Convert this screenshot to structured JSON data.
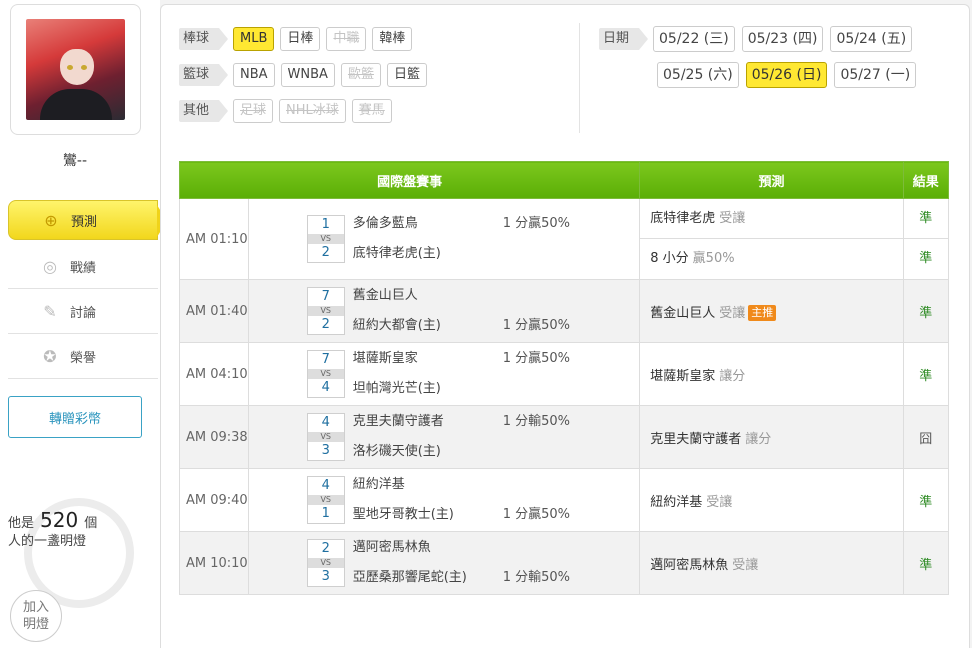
{
  "user": {
    "name": "鸞--"
  },
  "menu": [
    {
      "label": "預測",
      "icon": "crosshair-icon",
      "glyph": "⊕",
      "active": true
    },
    {
      "label": "戰績",
      "icon": "record-icon",
      "glyph": "◎",
      "active": false
    },
    {
      "label": "討論",
      "icon": "discussion-icon",
      "glyph": "✎",
      "active": false
    },
    {
      "label": "榮譽",
      "icon": "medal-icon",
      "glyph": "✪",
      "active": false
    }
  ],
  "gift_button": "轉贈彩幣",
  "light": {
    "text_prefix": "他是",
    "count": "520",
    "text_suffix": "個",
    "text_line2": "人的一盞明燈",
    "join": "加入明燈"
  },
  "filters": [
    {
      "category": "棒球",
      "chips": [
        {
          "label": "MLB",
          "state": "active"
        },
        {
          "label": "日棒",
          "state": "normal"
        },
        {
          "label": "中職",
          "state": "disabled"
        },
        {
          "label": "韓棒",
          "state": "normal"
        }
      ]
    },
    {
      "category": "籃球",
      "chips": [
        {
          "label": "NBA",
          "state": "normal"
        },
        {
          "label": "WNBA",
          "state": "normal"
        },
        {
          "label": "歐籃",
          "state": "disabled"
        },
        {
          "label": "日籃",
          "state": "normal"
        }
      ]
    },
    {
      "category": "其他",
      "chips": [
        {
          "label": "足球",
          "state": "disabled"
        },
        {
          "label": "NHL冰球",
          "state": "disabled"
        },
        {
          "label": "賽馬",
          "state": "disabled"
        }
      ]
    }
  ],
  "dates": {
    "label": "日期",
    "row1": [
      {
        "label": "05/22 (三)",
        "active": false
      },
      {
        "label": "05/23 (四)",
        "active": false
      },
      {
        "label": "05/24 (五)",
        "active": false
      }
    ],
    "row2": [
      {
        "label": "05/25 (六)",
        "active": false
      },
      {
        "label": "05/26 (日)",
        "active": true
      },
      {
        "label": "05/27 (一)",
        "active": false
      }
    ]
  },
  "table": {
    "headers": {
      "match": "國際盤賽事",
      "prediction": "預測",
      "result": "結果"
    },
    "vs_label": "VS",
    "games": [
      {
        "time": "AM 01:10",
        "away": {
          "score": "1",
          "name": "多倫多藍鳥",
          "odds": "1 分贏50%"
        },
        "home": {
          "score": "2",
          "name": "底特律老虎(主)",
          "odds": ""
        },
        "predictions": [
          {
            "main": "底特律老虎",
            "sub": "受讓",
            "badge": "",
            "result": "準",
            "result_type": "win"
          },
          {
            "main": "8 小分",
            "sub": "贏50%",
            "badge": "",
            "result": "準",
            "result_type": "win"
          }
        ]
      },
      {
        "time": "AM 01:40",
        "away": {
          "score": "7",
          "name": "舊金山巨人",
          "odds": ""
        },
        "home": {
          "score": "2",
          "name": "紐約大都會(主)",
          "odds": "1 分贏50%"
        },
        "predictions": [
          {
            "main": "舊金山巨人",
            "sub": "受讓",
            "badge": "主推",
            "result": "準",
            "result_type": "win"
          }
        ]
      },
      {
        "time": "AM 04:10",
        "away": {
          "score": "7",
          "name": "堪薩斯皇家",
          "odds": "1 分贏50%"
        },
        "home": {
          "score": "4",
          "name": "坦帕灣光芒(主)",
          "odds": ""
        },
        "predictions": [
          {
            "main": "堪薩斯皇家",
            "sub": "讓分",
            "badge": "",
            "result": "準",
            "result_type": "win"
          }
        ]
      },
      {
        "time": "AM 09:38",
        "away": {
          "score": "4",
          "name": "克里夫蘭守護者",
          "odds": "1 分輸50%"
        },
        "home": {
          "score": "3",
          "name": "洛杉磯天使(主)",
          "odds": ""
        },
        "predictions": [
          {
            "main": "克里夫蘭守護者",
            "sub": "讓分",
            "badge": "",
            "result": "囧",
            "result_type": "lose"
          }
        ]
      },
      {
        "time": "AM 09:40",
        "away": {
          "score": "4",
          "name": "紐約洋基",
          "odds": ""
        },
        "home": {
          "score": "1",
          "name": "聖地牙哥教士(主)",
          "odds": "1 分贏50%"
        },
        "predictions": [
          {
            "main": "紐約洋基",
            "sub": "受讓",
            "badge": "",
            "result": "準",
            "result_type": "win"
          }
        ]
      },
      {
        "time": "AM 10:10",
        "away": {
          "score": "2",
          "name": "邁阿密馬林魚",
          "odds": ""
        },
        "home": {
          "score": "3",
          "name": "亞歷桑那響尾蛇(主)",
          "odds": "1 分輸50%"
        },
        "predictions": [
          {
            "main": "邁阿密馬林魚",
            "sub": "受讓",
            "badge": "",
            "result": "準",
            "result_type": "win"
          }
        ]
      }
    ]
  }
}
